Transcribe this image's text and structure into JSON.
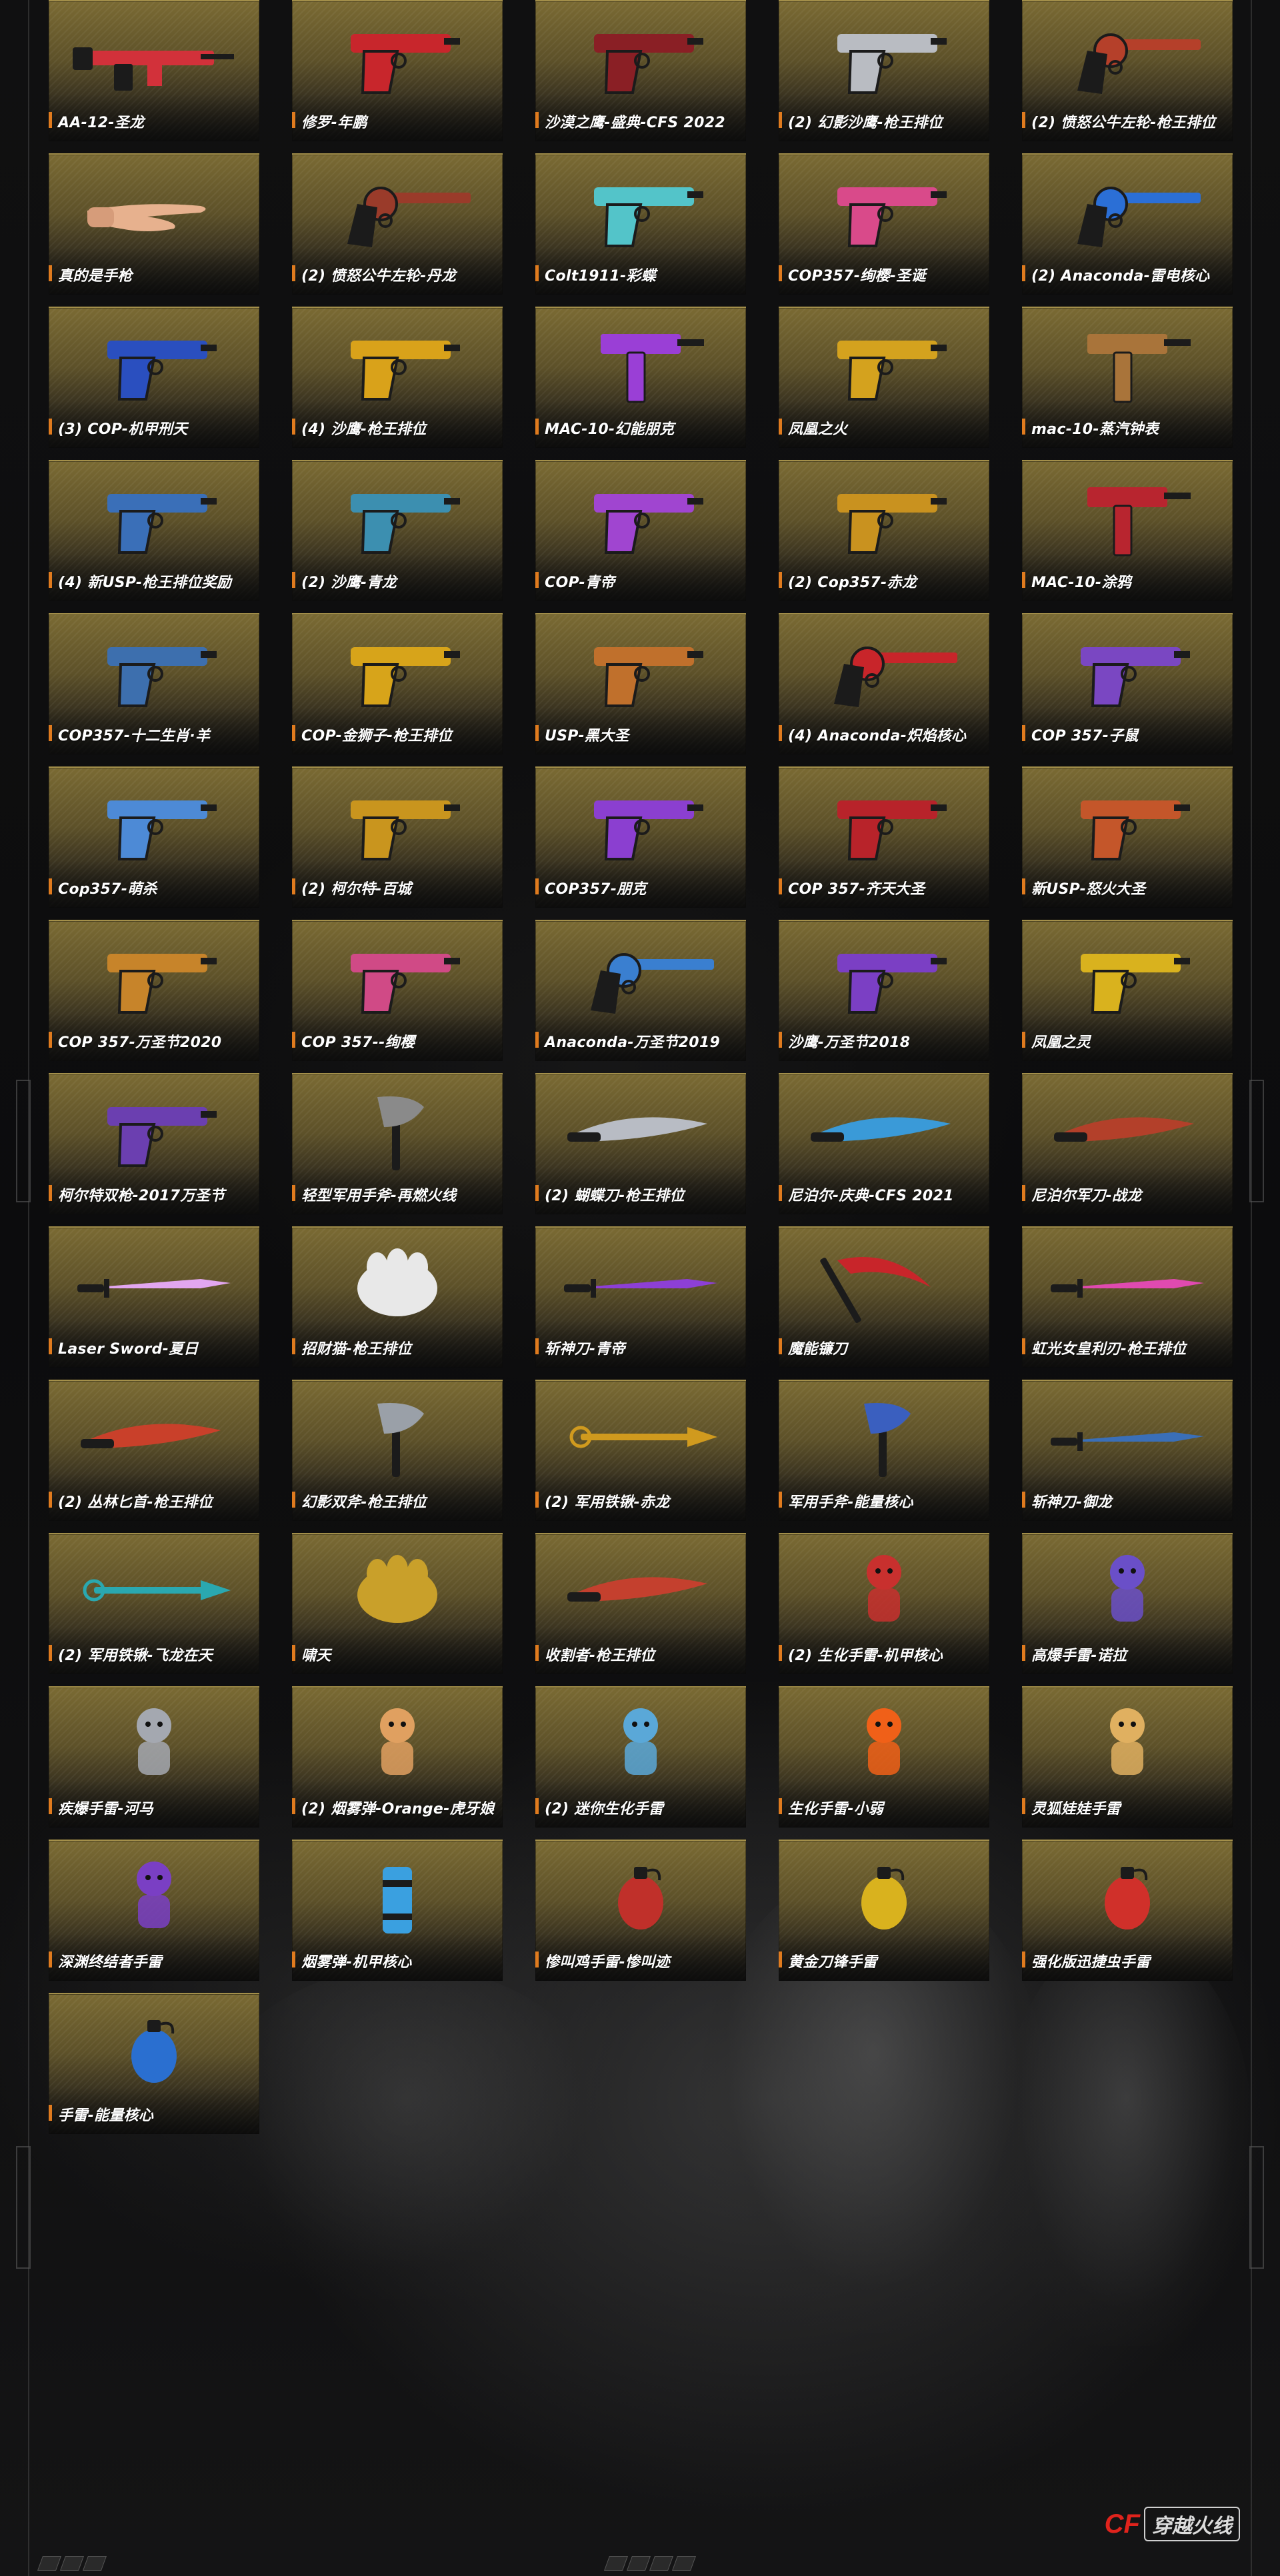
{
  "items": [
    {
      "label": "AA-12-圣龙",
      "icon": "rifle-icon",
      "kind": "rifle",
      "color": "#d2313a"
    },
    {
      "label": "修罗-年鹏",
      "icon": "pistol-icon",
      "kind": "pistol",
      "color": "#c8262c"
    },
    {
      "label": "沙漠之鹰-盛典-CFS 2022",
      "icon": "pistol-icon",
      "kind": "pistol",
      "color": "#8a1f25"
    },
    {
      "label": "(2) 幻影沙鹰-枪王排位",
      "icon": "pistol-icon",
      "kind": "pistol",
      "color": "#b9bcc2"
    },
    {
      "label": "(2) 愤怒公牛左轮-枪王排位",
      "icon": "revolver-icon",
      "kind": "revolver",
      "color": "#b5402a"
    },
    {
      "label": "真的是手枪",
      "icon": "hand-icon",
      "kind": "hand",
      "color": "#e7b18e"
    },
    {
      "label": "(2) 愤怒公牛左轮-丹龙",
      "icon": "revolver-icon",
      "kind": "revolver",
      "color": "#9a3b2a"
    },
    {
      "label": "Colt1911-彩蝶",
      "icon": "pistol-icon",
      "kind": "pistol",
      "color": "#53c4c9"
    },
    {
      "label": "COP357-绚樱-圣诞",
      "icon": "pistol-icon",
      "kind": "pistol",
      "color": "#d94a8a"
    },
    {
      "label": "(2) Anaconda-雷电核心",
      "icon": "revolver-icon",
      "kind": "revolver",
      "color": "#2b6fd6"
    },
    {
      "label": "(3) COP-机甲刑天",
      "icon": "pistol-icon",
      "kind": "pistol",
      "color": "#2a4fbf"
    },
    {
      "label": "(4) 沙鹰-枪王排位",
      "icon": "pistol-icon",
      "kind": "pistol",
      "color": "#d9a21a"
    },
    {
      "label": "MAC-10-幻能朋克",
      "icon": "smg-icon",
      "kind": "smg",
      "color": "#9a3fd6"
    },
    {
      "label": "凤凰之火",
      "icon": "pistol-icon",
      "kind": "pistol",
      "color": "#d4a21e"
    },
    {
      "label": "mac-10-蒸汽钟表",
      "icon": "smg-icon",
      "kind": "smg",
      "color": "#a9743a"
    },
    {
      "label": "(4) 新USP-枪王排位奖励",
      "icon": "pistol-icon",
      "kind": "pistol",
      "color": "#3a6fb8"
    },
    {
      "label": "(2) 沙鹰-青龙",
      "icon": "pistol-icon",
      "kind": "pistol",
      "color": "#3c8fb0"
    },
    {
      "label": "COP-青帝",
      "icon": "pistol-icon",
      "kind": "pistol",
      "color": "#a045d0"
    },
    {
      "label": "(2) Cop357-赤龙",
      "icon": "pistol-icon",
      "kind": "pistol",
      "color": "#c9921f"
    },
    {
      "label": "MAC-10-涂鸦",
      "icon": "smg-icon",
      "kind": "smg",
      "color": "#b8252f"
    },
    {
      "label": "COP357-十二生肖·羊",
      "icon": "pistol-icon",
      "kind": "pistol",
      "color": "#3d6fae"
    },
    {
      "label": "COP-金狮子-枪王排位",
      "icon": "pistol-icon",
      "kind": "pistol",
      "color": "#d7a41a"
    },
    {
      "label": "USP-黑大圣",
      "icon": "pistol-icon",
      "kind": "pistol",
      "color": "#c0702c"
    },
    {
      "label": "(4) Anaconda-炽焰核心",
      "icon": "revolver-icon",
      "kind": "revolver",
      "color": "#c8252a"
    },
    {
      "label": "COP 357-子鼠",
      "icon": "pistol-icon",
      "kind": "pistol",
      "color": "#7a47c2"
    },
    {
      "label": "Cop357-萌杀",
      "icon": "pistol-icon",
      "kind": "pistol",
      "color": "#4d8ad6"
    },
    {
      "label": "(2) 柯尔特-百城",
      "icon": "pistol-icon",
      "kind": "pistol",
      "color": "#c9951e"
    },
    {
      "label": "COP357-朋克",
      "icon": "pistol-icon",
      "kind": "pistol",
      "color": "#8b3fd0"
    },
    {
      "label": "COP 357-齐天大圣",
      "icon": "pistol-icon",
      "kind": "pistol",
      "color": "#b8232a"
    },
    {
      "label": "新USP-怒火大圣",
      "icon": "pistol-icon",
      "kind": "pistol",
      "color": "#c4562a"
    },
    {
      "label": "COP 357-万圣节2020",
      "icon": "pistol-icon",
      "kind": "pistol",
      "color": "#c7842a"
    },
    {
      "label": "COP 357--绚樱",
      "icon": "pistol-icon",
      "kind": "pistol",
      "color": "#d04a86"
    },
    {
      "label": "Anaconda-万圣节2019",
      "icon": "revolver-icon",
      "kind": "revolver",
      "color": "#3a7fd0"
    },
    {
      "label": "沙鹰-万圣节2018",
      "icon": "pistol-icon",
      "kind": "pistol",
      "color": "#7b3fc4"
    },
    {
      "label": "凤凰之灵",
      "icon": "pistol-icon",
      "kind": "pistol",
      "color": "#d9b21e"
    },
    {
      "label": "柯尔特双枪-2017万圣节",
      "icon": "pistol-icon",
      "kind": "pistol",
      "color": "#6b3fb0"
    },
    {
      "label": "轻型军用手斧-再燃火线",
      "icon": "axe-icon",
      "kind": "axe",
      "color": "#8a8a8a"
    },
    {
      "label": "(2) 蝴蝶刀-枪王排位",
      "icon": "knife-icon",
      "kind": "knife",
      "color": "#b8bcc4"
    },
    {
      "label": "尼泊尔-庆典-CFS 2021",
      "icon": "knife-icon",
      "kind": "knife",
      "color": "#3a9ad8"
    },
    {
      "label": "尼泊尔军刀-战龙",
      "icon": "knife-icon",
      "kind": "knife",
      "color": "#b3402a"
    },
    {
      "label": "Laser Sword-夏日",
      "icon": "sword-icon",
      "kind": "sword",
      "color": "#e2a6f0"
    },
    {
      "label": "招财猫-枪王排位",
      "icon": "glove-icon",
      "kind": "glove",
      "color": "#e8e8e8"
    },
    {
      "label": "斩神刀-青帝",
      "icon": "sword-icon",
      "kind": "sword",
      "color": "#8d3fd6"
    },
    {
      "label": "魔能镰刀",
      "icon": "scythe-icon",
      "kind": "scythe",
      "color": "#c8252a"
    },
    {
      "label": "虹光女皇利刃-枪王排位",
      "icon": "sword-icon",
      "kind": "sword",
      "color": "#e04ab0"
    },
    {
      "label": "(2) 丛林匕首-枪王排位",
      "icon": "knife-icon",
      "kind": "knife",
      "color": "#c9402a"
    },
    {
      "label": "幻影双斧-枪王排位",
      "icon": "axe-icon",
      "kind": "axe",
      "color": "#9aa0a8"
    },
    {
      "label": "(2) 军用铁锹-赤龙",
      "icon": "shovel-icon",
      "kind": "shovel",
      "color": "#d09a1e"
    },
    {
      "label": "军用手斧-能量核心",
      "icon": "axe-icon",
      "kind": "axe",
      "color": "#3a5fbf"
    },
    {
      "label": "斩神刀-御龙",
      "icon": "sword-icon",
      "kind": "sword",
      "color": "#3a6fb8"
    },
    {
      "label": "(2) 军用铁锹-飞龙在天",
      "icon": "shovel-icon",
      "kind": "shovel",
      "color": "#2aa8b0"
    },
    {
      "label": "啸天",
      "icon": "glove-icon",
      "kind": "glove",
      "color": "#c9a02a"
    },
    {
      "label": "收割者-枪王排位",
      "icon": "knife-icon",
      "kind": "knife",
      "color": "#c4402e"
    },
    {
      "label": "(2) 生化手雷-机甲核心",
      "icon": "figure-icon",
      "kind": "figure",
      "color": "#c8302e"
    },
    {
      "label": "高爆手雷-诺拉",
      "icon": "figure-icon",
      "kind": "figure",
      "color": "#6a4fc8"
    },
    {
      "label": "疾爆手雷-河马",
      "icon": "figure-icon",
      "kind": "figure",
      "color": "#a4a8b0"
    },
    {
      "label": "(2) 烟雾弹-Orange-虎牙娘",
      "icon": "figure-icon",
      "kind": "figure",
      "color": "#e0a060"
    },
    {
      "label": "(2) 迷你生化手雷",
      "icon": "figure-icon",
      "kind": "figure",
      "color": "#5aa8d8"
    },
    {
      "label": "生化手雷-小弱",
      "icon": "figure-icon",
      "kind": "figure",
      "color": "#f06018"
    },
    {
      "label": "灵狐娃娃手雷",
      "icon": "figure-icon",
      "kind": "figure",
      "color": "#e0b060"
    },
    {
      "label": "深渊终结者手雷",
      "icon": "figure-icon",
      "kind": "figure",
      "color": "#7a3fc4"
    },
    {
      "label": "烟雾弹-机甲核心",
      "icon": "grenade-icon",
      "kind": "canister",
      "color": "#3aa0e0"
    },
    {
      "label": "惨叫鸡手雷-惨叫迹",
      "icon": "grenade-icon",
      "kind": "grenade",
      "color": "#c0302a"
    },
    {
      "label": "黄金刀锋手雷",
      "icon": "grenade-icon",
      "kind": "grenade",
      "color": "#d9b21e"
    },
    {
      "label": "强化版迅捷虫手雷",
      "icon": "grenade-icon",
      "kind": "grenade",
      "color": "#d0302a"
    },
    {
      "label": "手雷-能量核心",
      "icon": "grenade-icon",
      "kind": "grenade",
      "color": "#2a6fd0"
    }
  ],
  "logo": {
    "text": "穿越火线"
  }
}
